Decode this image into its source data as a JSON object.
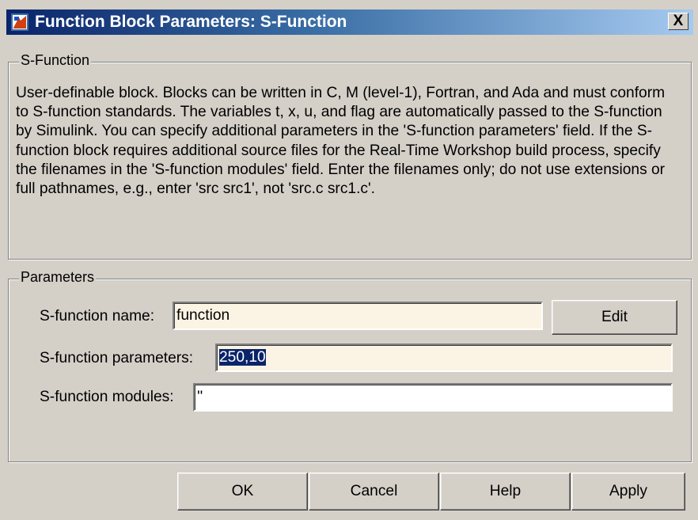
{
  "window": {
    "title": "Function Block Parameters: S-Function",
    "close_label": "X"
  },
  "sfunction_group": {
    "legend": "S-Function",
    "description": "User-definable block.  Blocks can be written in C, M (level-1), Fortran, and Ada and must conform to S-function standards.  The variables t, x, u, and flag are automatically passed to the S-function by Simulink.  You can specify additional parameters in the 'S-function parameters' field. If the S-function block requires additional source files for the Real-Time Workshop build process, specify the filenames in the 'S-function modules' field. Enter the filenames only; do not use extensions or full pathnames, e.g., enter 'src src1', not 'src.c src1.c'."
  },
  "parameters_group": {
    "legend": "Parameters",
    "name_label": "S-function name:",
    "name_value": "function",
    "edit_label": "Edit",
    "params_label": "S-function parameters:",
    "params_value": "250,10",
    "modules_label": "S-function modules:",
    "modules_value": "''"
  },
  "buttons": {
    "ok": "OK",
    "cancel": "Cancel",
    "help": "Help",
    "apply": "Apply"
  },
  "colors": {
    "title_gradient_start": "#0a246a",
    "title_gradient_end": "#a6caf0",
    "dialog_bg": "#d4d0c8",
    "field_highlight": "#fbf4e4",
    "selection": "#0a246a"
  },
  "icons": {
    "app": "simulink-block-icon",
    "close": "close-icon"
  }
}
